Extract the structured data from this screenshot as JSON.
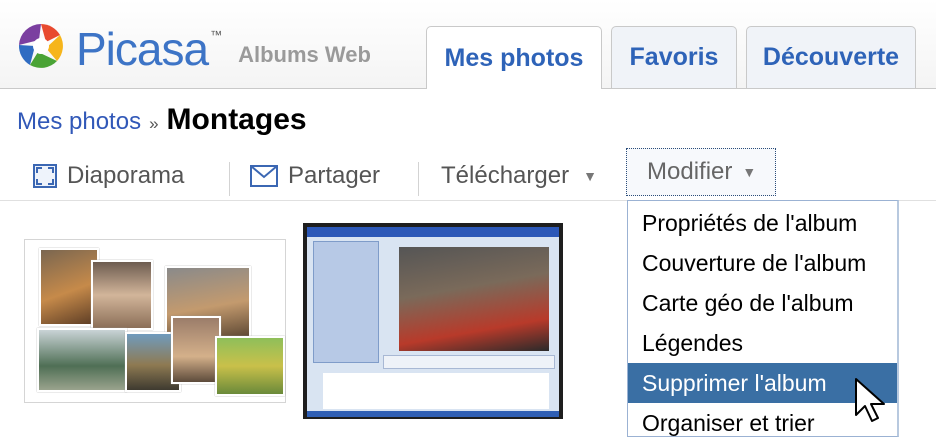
{
  "header": {
    "logo_text": "Picasa",
    "logo_tm": "™",
    "logo_subtitle": "Albums Web",
    "tabs": [
      {
        "label": "Mes photos",
        "active": true
      },
      {
        "label": "Favoris",
        "active": false
      },
      {
        "label": "Découverte",
        "active": false
      }
    ]
  },
  "breadcrumb": {
    "parent": "Mes photos",
    "separator": "»",
    "current": "Montages"
  },
  "toolbar": {
    "slideshow": "Diaporama",
    "share": "Partager",
    "download": "Télécharger",
    "edit": "Modifier"
  },
  "edit_menu": {
    "items": [
      "Propriétés de l'album",
      "Couverture de l'album",
      "Carte géo de l'album",
      "Légendes",
      "Supprimer l'album",
      "Organiser et trier"
    ],
    "highlighted_index": 4
  },
  "colors": {
    "link": "#3158b8",
    "tab_text": "#2e63b8",
    "menu_highlight": "#3a6fa4"
  },
  "icons": [
    "slideshow-icon",
    "envelope-icon",
    "dropdown-caret-icon",
    "pointer-cursor-icon",
    "picasa-logo-icon"
  ]
}
